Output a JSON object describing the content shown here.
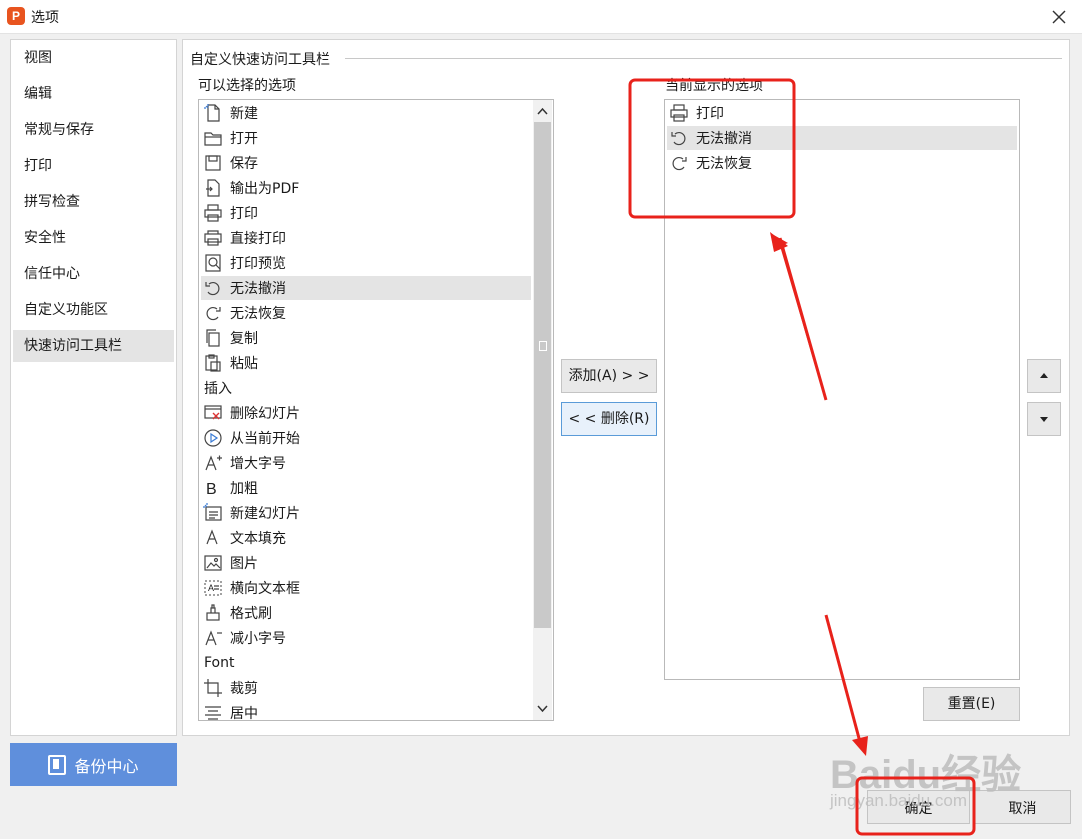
{
  "window": {
    "title": "选项",
    "logo_letter": "P"
  },
  "nav": {
    "items": [
      "视图",
      "编辑",
      "常规与保存",
      "打印",
      "拼写检查",
      "安全性",
      "信任中心",
      "自定义功能区",
      "快速访问工具栏"
    ],
    "active_index": 8
  },
  "backup": {
    "label": "备份中心"
  },
  "main": {
    "group_title": "自定义快速访问工具栏",
    "available_label": "可以选择的选项",
    "current_label": "当前显示的选项"
  },
  "available_items": [
    {
      "label": "新建",
      "icon": "new-doc-icon"
    },
    {
      "label": "打开",
      "icon": "folder-open-icon"
    },
    {
      "label": "保存",
      "icon": "save-icon"
    },
    {
      "label": "输出为PDF",
      "icon": "pdf-export-icon"
    },
    {
      "label": "打印",
      "icon": "printer-icon"
    },
    {
      "label": "直接打印",
      "icon": "direct-print-icon"
    },
    {
      "label": "打印预览",
      "icon": "print-preview-icon"
    },
    {
      "label": "无法撤消",
      "icon": "undo-icon"
    },
    {
      "label": "无法恢复",
      "icon": "redo-icon"
    },
    {
      "label": "复制",
      "icon": "copy-icon"
    },
    {
      "label": "粘贴",
      "icon": "paste-icon"
    },
    {
      "label": "插入",
      "icon": ""
    },
    {
      "label": "删除幻灯片",
      "icon": "delete-slide-icon"
    },
    {
      "label": "从当前开始",
      "icon": "play-from-current-icon"
    },
    {
      "label": "增大字号",
      "icon": "font-grow-icon"
    },
    {
      "label": "加粗",
      "icon": "bold-icon"
    },
    {
      "label": "新建幻灯片",
      "icon": "new-slide-icon"
    },
    {
      "label": "文本填充",
      "icon": "text-fill-icon"
    },
    {
      "label": "图片",
      "icon": "picture-icon"
    },
    {
      "label": "横向文本框",
      "icon": "text-box-icon"
    },
    {
      "label": "格式刷",
      "icon": "format-painter-icon"
    },
    {
      "label": "减小字号",
      "icon": "font-shrink-icon"
    },
    {
      "label": "Font",
      "icon": ""
    },
    {
      "label": "裁剪",
      "icon": "crop-icon"
    },
    {
      "label": "居中",
      "icon": "align-center-icon"
    }
  ],
  "available_selected_index": 7,
  "current_items": [
    {
      "label": "打印",
      "icon": "printer-icon"
    },
    {
      "label": "无法撤消",
      "icon": "undo-icon"
    },
    {
      "label": "无法恢复",
      "icon": "redo-icon"
    }
  ],
  "current_selected_index": 1,
  "buttons": {
    "add": "添加(A) > >",
    "remove": "< < 删除(R)",
    "reset": "重置(E)",
    "ok": "确定",
    "cancel": "取消"
  },
  "watermark": {
    "brand": "Baidu经验",
    "url": "jingyan.baidu.com"
  },
  "colors": {
    "annotation_red": "#e8221b",
    "backup_blue": "#5f8fdc",
    "selected_row": "#e4e4e4"
  }
}
